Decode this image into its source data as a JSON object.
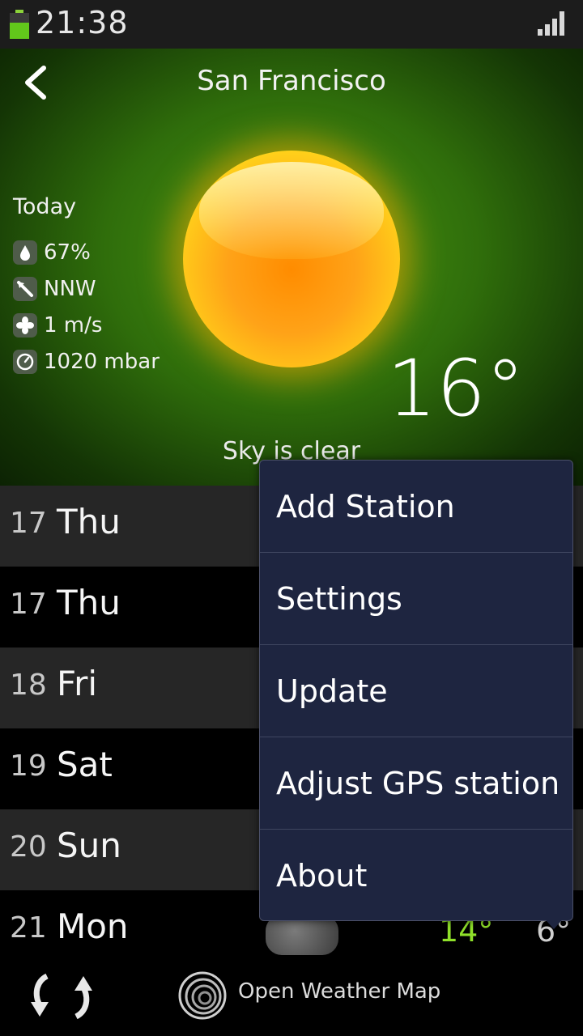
{
  "status_bar": {
    "time": "21:38",
    "battery_icon": "battery-icon",
    "signal_icon": "signal-icon",
    "battery_color": "#62c71b"
  },
  "header": {
    "city": "San Francisco",
    "back_icon": "chevron-left-icon"
  },
  "current": {
    "today_label": "Today",
    "humidity": "67%",
    "wind_direction": "NNW",
    "wind_speed": "1 m/s",
    "pressure": "1020 mbar",
    "temperature": "16°",
    "condition": "Sky is clear",
    "weather_icon": "sun-icon"
  },
  "forecast": [
    {
      "num": "17",
      "day": "Thu",
      "hi": "",
      "lo": ""
    },
    {
      "num": "17",
      "day": "Thu",
      "hi": "",
      "lo": ""
    },
    {
      "num": "18",
      "day": "Fri",
      "hi": "",
      "lo": ""
    },
    {
      "num": "19",
      "day": "Sat",
      "hi": "",
      "lo": ""
    },
    {
      "num": "20",
      "day": "Sun",
      "hi": "",
      "lo": ""
    },
    {
      "num": "21",
      "day": "Mon",
      "hi": "14°",
      "lo": "6°"
    }
  ],
  "menu": {
    "items": [
      "Add Station",
      "Settings",
      "Update",
      "Adjust GPS station",
      "About"
    ]
  },
  "bottom_bar": {
    "refresh_icon": "refresh-icon",
    "provider": "Open Weather Map",
    "provider_icon": "openweathermap-logo-icon"
  },
  "colors": {
    "hero_green": "#2f6d0b",
    "menu_bg": "#1e2540",
    "high_temp": "#8fe02a"
  }
}
